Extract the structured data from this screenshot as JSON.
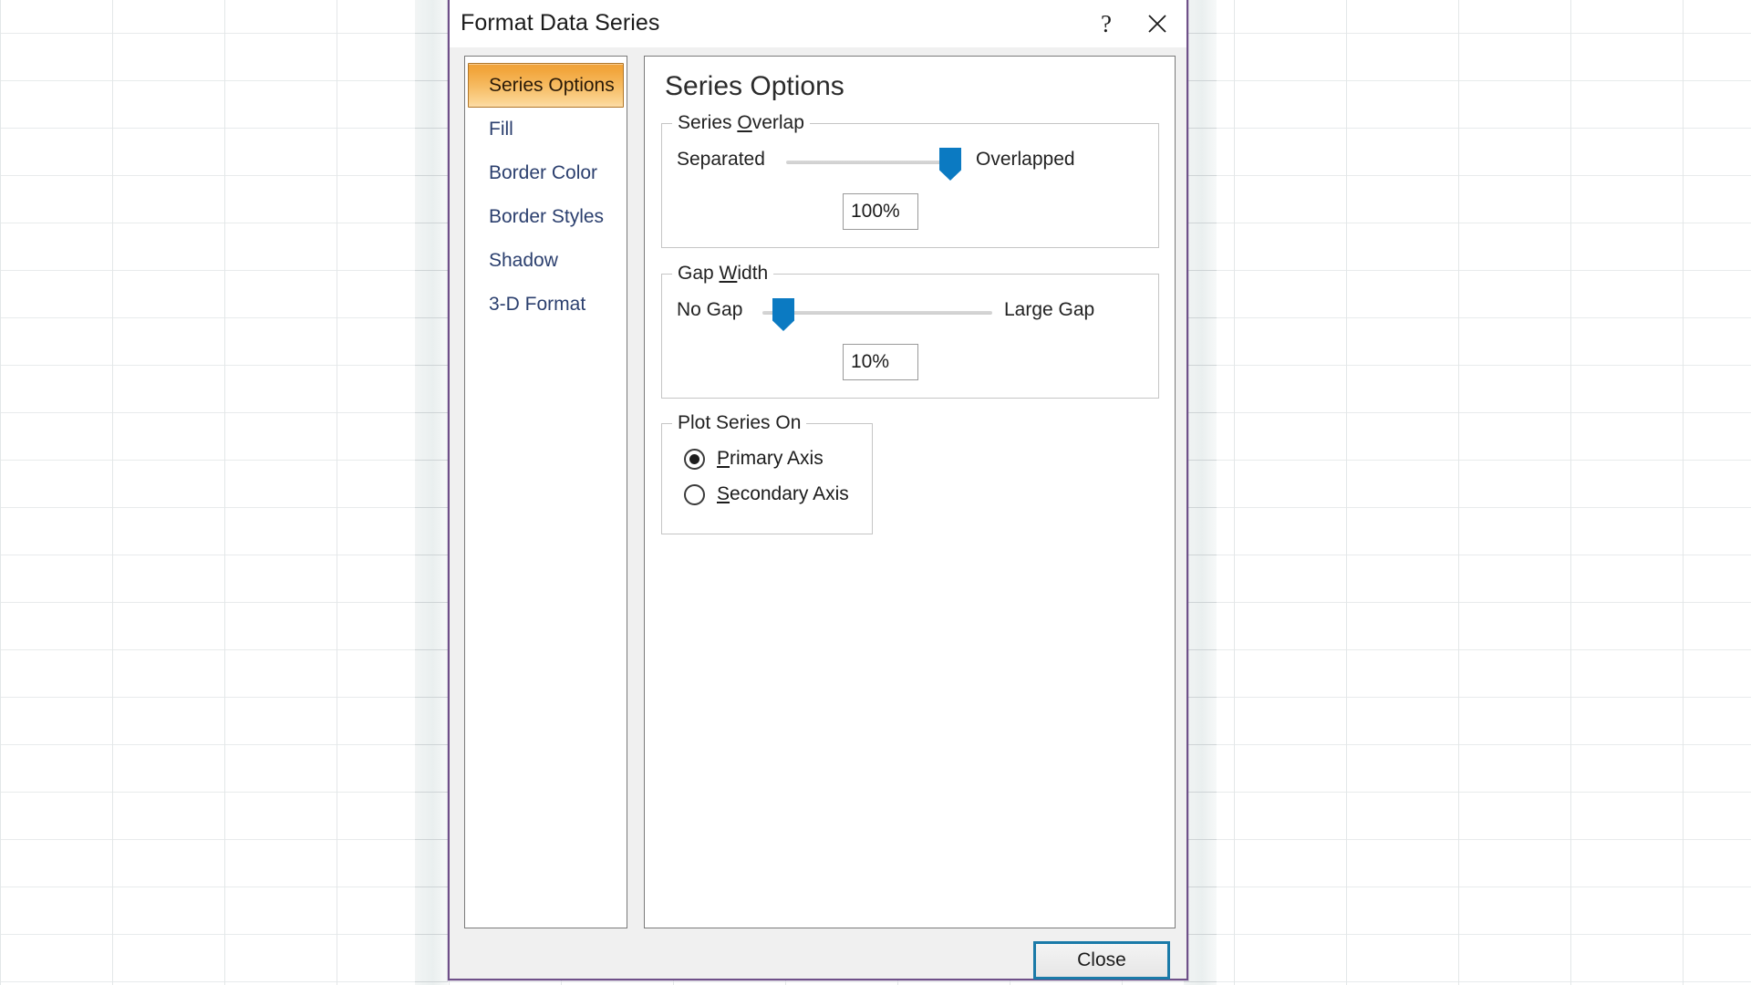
{
  "window": {
    "title": "Format Data Series",
    "help_icon": "question-mark-icon",
    "close_icon": "close-x-icon",
    "border_color": "#6f5089"
  },
  "sidebar": {
    "items": [
      {
        "label": "Series Options",
        "selected": true
      },
      {
        "label": "Fill",
        "selected": false
      },
      {
        "label": "Border Color",
        "selected": false
      },
      {
        "label": "Border Styles",
        "selected": false
      },
      {
        "label": "Shadow",
        "selected": false
      },
      {
        "label": "3-D Format",
        "selected": false
      }
    ],
    "selected_bg_top": "#f0a23a",
    "selected_bg_bottom": "#fcdca6",
    "link_color": "#2b3f6e"
  },
  "content": {
    "heading": "Series Options",
    "series_overlap": {
      "legend_prefix": "Series ",
      "legend_accel": "O",
      "legend_suffix": "verlap",
      "min_label": "Separated",
      "max_label": "Overlapped",
      "value": "100%",
      "thumb_percent": 100
    },
    "gap_width": {
      "legend_prefix": "Gap ",
      "legend_accel": "W",
      "legend_suffix": "idth",
      "min_label": "No Gap",
      "max_label": "Large Gap",
      "value": "10%",
      "thumb_percent": 5
    },
    "plot_series_on": {
      "legend": "Plot Series On",
      "options": [
        {
          "accel": "P",
          "rest": "rimary Axis",
          "checked": true
        },
        {
          "accel": "S",
          "rest": "econdary Axis",
          "checked": false
        }
      ]
    },
    "slider_accent": "#0b7ac2"
  },
  "footer": {
    "close_label": "Close",
    "focus_color": "#1a7aa8"
  }
}
